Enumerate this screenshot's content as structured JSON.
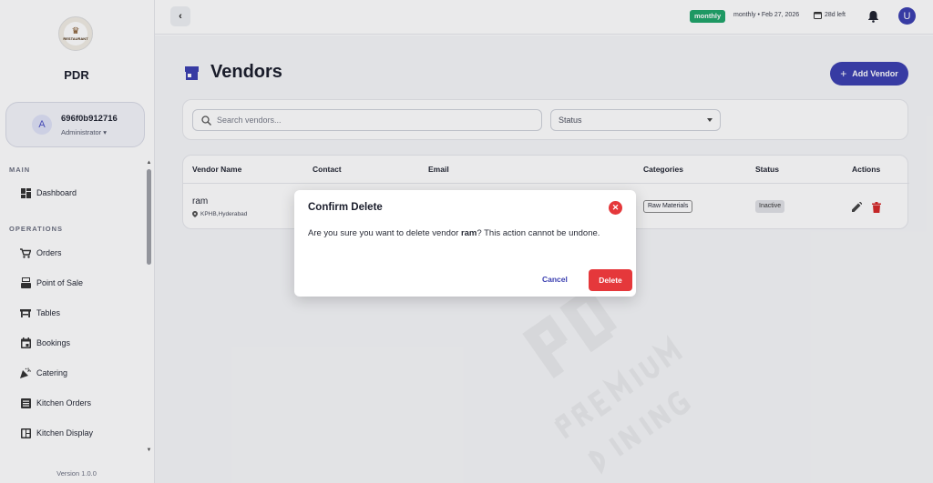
{
  "app": {
    "brand": "PDR",
    "logo_text": "RESTAURANT"
  },
  "user": {
    "initial": "A",
    "id": "696f0b912716",
    "role": "Administrator ▾"
  },
  "sidebar": {
    "sections": {
      "main": "MAIN",
      "operations": "OPERATIONS"
    },
    "main_items": [
      {
        "label": "Dashboard",
        "icon": "dashboard-icon"
      }
    ],
    "operations_items": [
      {
        "label": "Orders",
        "icon": "cart-icon"
      },
      {
        "label": "Point of Sale",
        "icon": "pos-icon"
      },
      {
        "label": "Tables",
        "icon": "table-icon"
      },
      {
        "label": "Bookings",
        "icon": "calendar-icon"
      },
      {
        "label": "Catering",
        "icon": "party-icon"
      },
      {
        "label": "Kitchen Orders",
        "icon": "list-icon"
      },
      {
        "label": "Kitchen Display",
        "icon": "display-icon"
      }
    ],
    "version": "Version 1.0.0"
  },
  "topbar": {
    "plan_badge": "monthly",
    "plan_info": "monthly • Feb 27, 2026",
    "days_left": "28d left",
    "avatar_initial": "U"
  },
  "page": {
    "title": "Vendors",
    "add_button": "Add Vendor",
    "add_plus": "+",
    "search_placeholder": "Search vendors...",
    "status_filter": "Status"
  },
  "table": {
    "headers": [
      "Vendor Name",
      "Contact",
      "Email",
      "Categories",
      "Status",
      "Actions"
    ],
    "rows": [
      {
        "name": "ram",
        "location": "KPHB,Hyderabad",
        "category": "Raw Materials",
        "status": "Inactive"
      }
    ]
  },
  "modal": {
    "title": "Confirm Delete",
    "close": "✕",
    "msg_prefix": "Are you sure you want to delete vendor ",
    "msg_vendor": "ram",
    "msg_suffix": "? This action cannot be undone.",
    "cancel": "Cancel",
    "confirm": "Delete"
  },
  "colors": {
    "primary": "#3b3fb0",
    "danger": "#e5383b",
    "success": "#1fa56a"
  }
}
